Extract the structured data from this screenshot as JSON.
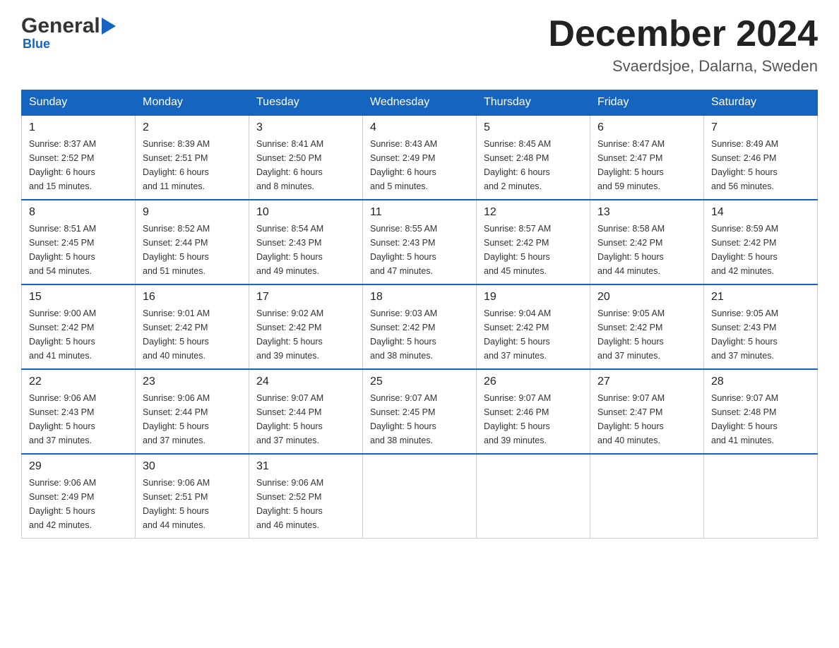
{
  "header": {
    "logo_general": "General",
    "logo_blue": "Blue",
    "main_title": "December 2024",
    "subtitle": "Svaerdsjoe, Dalarna, Sweden"
  },
  "calendar": {
    "days_of_week": [
      "Sunday",
      "Monday",
      "Tuesday",
      "Wednesday",
      "Thursday",
      "Friday",
      "Saturday"
    ],
    "weeks": [
      [
        {
          "day": "1",
          "info": "Sunrise: 8:37 AM\nSunset: 2:52 PM\nDaylight: 6 hours\nand 15 minutes."
        },
        {
          "day": "2",
          "info": "Sunrise: 8:39 AM\nSunset: 2:51 PM\nDaylight: 6 hours\nand 11 minutes."
        },
        {
          "day": "3",
          "info": "Sunrise: 8:41 AM\nSunset: 2:50 PM\nDaylight: 6 hours\nand 8 minutes."
        },
        {
          "day": "4",
          "info": "Sunrise: 8:43 AM\nSunset: 2:49 PM\nDaylight: 6 hours\nand 5 minutes."
        },
        {
          "day": "5",
          "info": "Sunrise: 8:45 AM\nSunset: 2:48 PM\nDaylight: 6 hours\nand 2 minutes."
        },
        {
          "day": "6",
          "info": "Sunrise: 8:47 AM\nSunset: 2:47 PM\nDaylight: 5 hours\nand 59 minutes."
        },
        {
          "day": "7",
          "info": "Sunrise: 8:49 AM\nSunset: 2:46 PM\nDaylight: 5 hours\nand 56 minutes."
        }
      ],
      [
        {
          "day": "8",
          "info": "Sunrise: 8:51 AM\nSunset: 2:45 PM\nDaylight: 5 hours\nand 54 minutes."
        },
        {
          "day": "9",
          "info": "Sunrise: 8:52 AM\nSunset: 2:44 PM\nDaylight: 5 hours\nand 51 minutes."
        },
        {
          "day": "10",
          "info": "Sunrise: 8:54 AM\nSunset: 2:43 PM\nDaylight: 5 hours\nand 49 minutes."
        },
        {
          "day": "11",
          "info": "Sunrise: 8:55 AM\nSunset: 2:43 PM\nDaylight: 5 hours\nand 47 minutes."
        },
        {
          "day": "12",
          "info": "Sunrise: 8:57 AM\nSunset: 2:42 PM\nDaylight: 5 hours\nand 45 minutes."
        },
        {
          "day": "13",
          "info": "Sunrise: 8:58 AM\nSunset: 2:42 PM\nDaylight: 5 hours\nand 44 minutes."
        },
        {
          "day": "14",
          "info": "Sunrise: 8:59 AM\nSunset: 2:42 PM\nDaylight: 5 hours\nand 42 minutes."
        }
      ],
      [
        {
          "day": "15",
          "info": "Sunrise: 9:00 AM\nSunset: 2:42 PM\nDaylight: 5 hours\nand 41 minutes."
        },
        {
          "day": "16",
          "info": "Sunrise: 9:01 AM\nSunset: 2:42 PM\nDaylight: 5 hours\nand 40 minutes."
        },
        {
          "day": "17",
          "info": "Sunrise: 9:02 AM\nSunset: 2:42 PM\nDaylight: 5 hours\nand 39 minutes."
        },
        {
          "day": "18",
          "info": "Sunrise: 9:03 AM\nSunset: 2:42 PM\nDaylight: 5 hours\nand 38 minutes."
        },
        {
          "day": "19",
          "info": "Sunrise: 9:04 AM\nSunset: 2:42 PM\nDaylight: 5 hours\nand 37 minutes."
        },
        {
          "day": "20",
          "info": "Sunrise: 9:05 AM\nSunset: 2:42 PM\nDaylight: 5 hours\nand 37 minutes."
        },
        {
          "day": "21",
          "info": "Sunrise: 9:05 AM\nSunset: 2:43 PM\nDaylight: 5 hours\nand 37 minutes."
        }
      ],
      [
        {
          "day": "22",
          "info": "Sunrise: 9:06 AM\nSunset: 2:43 PM\nDaylight: 5 hours\nand 37 minutes."
        },
        {
          "day": "23",
          "info": "Sunrise: 9:06 AM\nSunset: 2:44 PM\nDaylight: 5 hours\nand 37 minutes."
        },
        {
          "day": "24",
          "info": "Sunrise: 9:07 AM\nSunset: 2:44 PM\nDaylight: 5 hours\nand 37 minutes."
        },
        {
          "day": "25",
          "info": "Sunrise: 9:07 AM\nSunset: 2:45 PM\nDaylight: 5 hours\nand 38 minutes."
        },
        {
          "day": "26",
          "info": "Sunrise: 9:07 AM\nSunset: 2:46 PM\nDaylight: 5 hours\nand 39 minutes."
        },
        {
          "day": "27",
          "info": "Sunrise: 9:07 AM\nSunset: 2:47 PM\nDaylight: 5 hours\nand 40 minutes."
        },
        {
          "day": "28",
          "info": "Sunrise: 9:07 AM\nSunset: 2:48 PM\nDaylight: 5 hours\nand 41 minutes."
        }
      ],
      [
        {
          "day": "29",
          "info": "Sunrise: 9:06 AM\nSunset: 2:49 PM\nDaylight: 5 hours\nand 42 minutes."
        },
        {
          "day": "30",
          "info": "Sunrise: 9:06 AM\nSunset: 2:51 PM\nDaylight: 5 hours\nand 44 minutes."
        },
        {
          "day": "31",
          "info": "Sunrise: 9:06 AM\nSunset: 2:52 PM\nDaylight: 5 hours\nand 46 minutes."
        },
        {
          "day": "",
          "info": ""
        },
        {
          "day": "",
          "info": ""
        },
        {
          "day": "",
          "info": ""
        },
        {
          "day": "",
          "info": ""
        }
      ]
    ]
  }
}
